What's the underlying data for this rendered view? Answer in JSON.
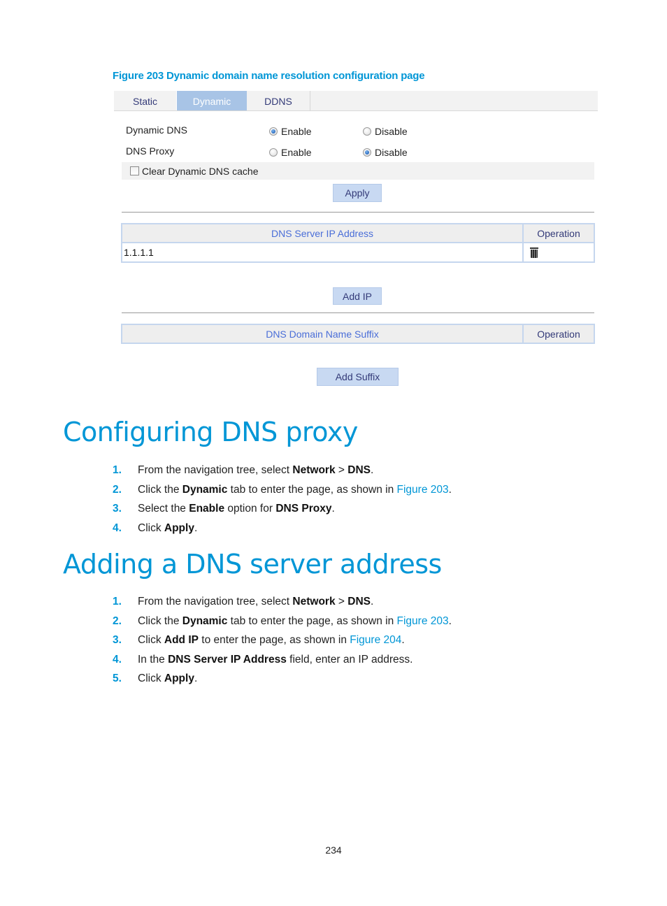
{
  "figure": {
    "caption": "Figure 203 Dynamic domain name resolution configuration page",
    "tabs": [
      {
        "label": "Static",
        "active": false
      },
      {
        "label": "Dynamic",
        "active": true
      },
      {
        "label": "DDNS",
        "active": false
      }
    ],
    "settings": [
      {
        "label": "Dynamic DNS",
        "options": [
          "Enable",
          "Disable"
        ],
        "selected": "Enable"
      },
      {
        "label": "DNS Proxy",
        "options": [
          "Enable",
          "Disable"
        ],
        "selected": "Disable"
      }
    ],
    "clear_cache": {
      "label": "Clear Dynamic DNS cache",
      "checked": false
    },
    "apply_label": "Apply",
    "server_table": {
      "columns": [
        "DNS Server IP Address",
        "Operation"
      ],
      "rows": [
        {
          "ip": "1.1.1.1",
          "operation_icon": "trash-icon"
        }
      ]
    },
    "add_ip_label": "Add IP",
    "suffix_table": {
      "columns": [
        "DNS Domain Name Suffix",
        "Operation"
      ],
      "rows": []
    },
    "add_suffix_label": "Add Suffix"
  },
  "section1": {
    "title": "Configuring DNS proxy",
    "steps": [
      {
        "num": "1.",
        "parts": [
          {
            "t": "From the navigation tree, select "
          },
          {
            "b": "Network"
          },
          {
            "t": " > "
          },
          {
            "b": "DNS"
          },
          {
            "t": "."
          }
        ]
      },
      {
        "num": "2.",
        "parts": [
          {
            "t": "Click the "
          },
          {
            "b": "Dynamic"
          },
          {
            "t": " tab to enter the page, as shown in "
          },
          {
            "l": "Figure 203"
          },
          {
            "t": "."
          }
        ]
      },
      {
        "num": "3.",
        "parts": [
          {
            "t": "Select the "
          },
          {
            "b": "Enable"
          },
          {
            "t": " option for "
          },
          {
            "b": "DNS Proxy"
          },
          {
            "t": "."
          }
        ]
      },
      {
        "num": "4.",
        "parts": [
          {
            "t": "Click "
          },
          {
            "b": "Apply"
          },
          {
            "t": "."
          }
        ]
      }
    ]
  },
  "section2": {
    "title": "Adding a DNS server address",
    "steps": [
      {
        "num": "1.",
        "parts": [
          {
            "t": "From the navigation tree, select "
          },
          {
            "b": "Network"
          },
          {
            "t": " > "
          },
          {
            "b": "DNS"
          },
          {
            "t": "."
          }
        ]
      },
      {
        "num": "2.",
        "parts": [
          {
            "t": "Click the "
          },
          {
            "b": "Dynamic"
          },
          {
            "t": " tab to enter the page, as shown in "
          },
          {
            "l": "Figure 203"
          },
          {
            "t": "."
          }
        ]
      },
      {
        "num": "3.",
        "parts": [
          {
            "t": "Click "
          },
          {
            "b": "Add IP"
          },
          {
            "t": " to enter the page, as shown in "
          },
          {
            "l": "Figure 204"
          },
          {
            "t": "."
          }
        ]
      },
      {
        "num": "4.",
        "parts": [
          {
            "t": "In the "
          },
          {
            "b": "DNS Server IP Address"
          },
          {
            "t": " field, enter an IP address."
          }
        ]
      },
      {
        "num": "5.",
        "parts": [
          {
            "t": "Click "
          },
          {
            "b": "Apply"
          },
          {
            "t": "."
          }
        ]
      }
    ]
  },
  "page_number": "234",
  "colors": {
    "accent": "#0096d6",
    "tab_active": "#a8c4e6",
    "button": "#c8d9f2"
  }
}
